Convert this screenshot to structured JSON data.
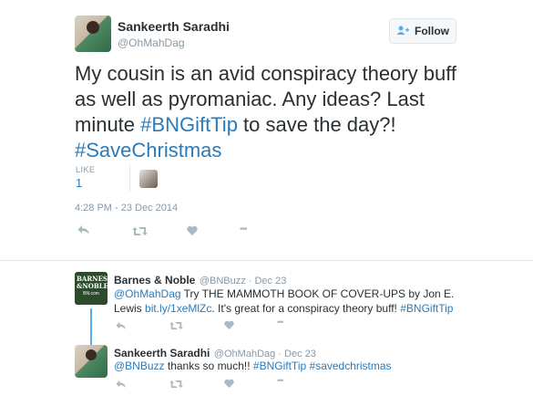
{
  "main_tweet": {
    "author_name": "Sankeerth Saradhi",
    "author_handle": "@OhMahDag",
    "follow_label": "Follow",
    "text_pre": "My cousin is an avid conspiracy theory buff as well as pyromaniac. Any ideas? Last minute ",
    "hashtag1": "#BNGiftTip",
    "text_mid": " to save the day?! ",
    "hashtag2": "#SaveChristmas",
    "likes_label": "LIKE",
    "likes_count": "1",
    "timestamp": "4:28 PM - 23 Dec 2014",
    "actions": {
      "reply": "↰",
      "retweet": "⇄",
      "like": "♥",
      "more": "•••"
    }
  },
  "replies": [
    {
      "author_name": "Barnes & Noble",
      "author_handle": "@BNBuzz · Dec 23",
      "logo_line1": "BARNES",
      "logo_line2": "&NOBLE",
      "logo_line3": "BN.com",
      "mention": "@OhMahDag",
      "text": " Try THE MAMMOTH BOOK OF COVER-UPS by Jon E. Lewis ",
      "link": "bit.ly/1xeMlZc",
      "text2": ". It's great for a conspiracy theory buff! ",
      "hashtag": "#BNGiftTip"
    },
    {
      "author_name": "Sankeerth Saradhi",
      "author_handle": "@OhMahDag · Dec 23",
      "mention": "@BNBuzz",
      "text": " thanks so much!! ",
      "hashtag1": "#BNGiftTip",
      "hashtag2": "#savedchristmas"
    }
  ],
  "colors": {
    "link": "#2b7bb9",
    "text": "#292f33",
    "muted": "#8899a6",
    "icon": "#aab8c2",
    "bn_green": "#2c4a2c"
  }
}
